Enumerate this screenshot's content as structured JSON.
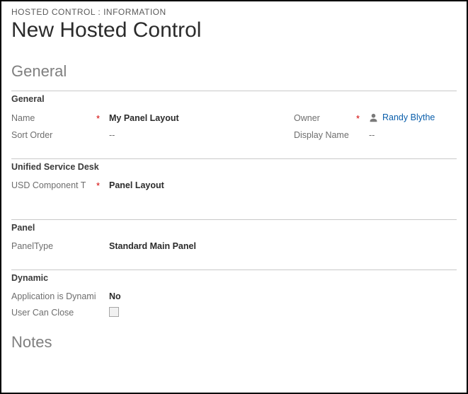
{
  "breadcrumb": "HOSTED CONTROL : INFORMATION",
  "pageTitle": "New Hosted Control",
  "sections": {
    "general": {
      "title": "General",
      "sub_general": {
        "header": "General",
        "name": {
          "label": "Name",
          "required": "*",
          "value": "My Panel Layout"
        },
        "sortOrder": {
          "label": "Sort Order",
          "value": "--"
        },
        "owner": {
          "label": "Owner",
          "required": "*",
          "value": "Randy Blythe"
        },
        "displayName": {
          "label": "Display Name",
          "value": "--"
        }
      },
      "sub_usd": {
        "header": "Unified Service Desk",
        "componentType": {
          "label": "USD Component T",
          "required": "*",
          "value": "Panel Layout"
        }
      },
      "sub_panel": {
        "header": "Panel",
        "panelType": {
          "label": "PanelType",
          "value": "Standard Main Panel"
        }
      },
      "sub_dynamic": {
        "header": "Dynamic",
        "appIsDynamic": {
          "label": "Application is Dynami",
          "value": "No"
        },
        "userCanClose": {
          "label": "User Can Close"
        }
      }
    },
    "notes": {
      "title": "Notes"
    }
  }
}
